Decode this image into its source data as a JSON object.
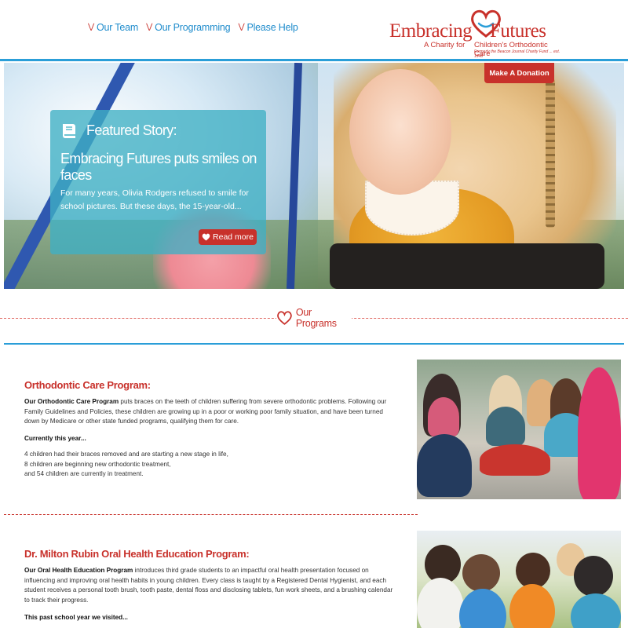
{
  "nav": {
    "items": [
      {
        "label": "Our Team"
      },
      {
        "label": "Our Programming"
      },
      {
        "label": "Please Help"
      }
    ]
  },
  "logo": {
    "word1": "Embracing",
    "word2": "Futures",
    "tagline1": "A Charity for",
    "tagline2": "Children's Orthodontic Care",
    "tagline3": "Formerly the Beacon Journal Charity Fund ... est. 1948"
  },
  "hero": {
    "donate_label": "Make A Donation",
    "story_label": "Featured Story:",
    "story_title": "Embracing Futures puts smiles on faces",
    "story_excerpt": "For many years, Olivia Rodgers refused to smile for school pictures. But these days, the 15-year-old...",
    "read_more_label": "Read more"
  },
  "programs_heading": "Our Programs",
  "sections": [
    {
      "title": "Orthodontic Care Program:",
      "lead": "Our Orthodontic Care Program",
      "text": " puts braces on the teeth of children suffering from severe orthodontic problems. Following our Family Guidelines and Policies, these children are growing up in a poor or working poor family situation, and have been turned down by Medicare or other state funded programs, qualifying them for care.",
      "subheading": "Currently this year...",
      "list": [
        "4 children had their braces removed and are starting a new stage in life,",
        "8 children are beginning new orthodontic treatment,",
        "and 54 children are currently in treatment."
      ]
    },
    {
      "title": "Dr. Milton Rubin Oral Health Education Program:",
      "lead": "Our Oral Health Education Program",
      "text": " introduces third grade students to an impactful oral health presentation focused on influencing and improving oral health habits in young children. Every class is taught by a Registered Dental Hygienist, and each student receives a personal tooth brush, tooth paste, dental floss and disclosing tablets, fun work sheets, and a brushing calendar to track their progress.",
      "subheading": "This past school year we visited..."
    }
  ],
  "colors": {
    "brand_red": "#c8312b",
    "brand_blue": "#2a9ed8",
    "story_teal": "#3fb0c4"
  }
}
